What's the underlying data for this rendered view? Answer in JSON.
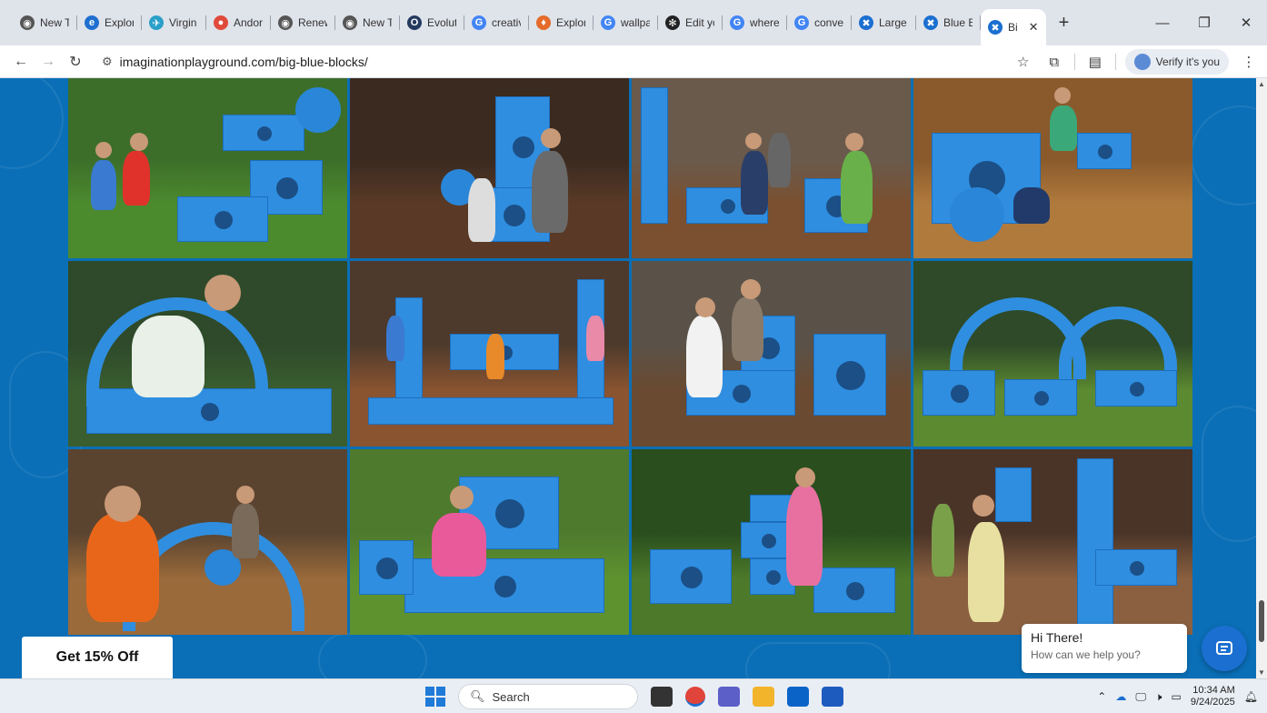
{
  "browser": {
    "tabs": [
      {
        "title": "New T",
        "icon": "chrome-icon",
        "color": "#555555",
        "glyph": "◉"
      },
      {
        "title": "Explor",
        "icon": "edge-icon",
        "color": "#1f6fd0",
        "glyph": "e"
      },
      {
        "title": "Virgin",
        "icon": "airline-icon",
        "color": "#2aa0c8",
        "glyph": "✈"
      },
      {
        "title": "Andor",
        "icon": "maps-pin-icon",
        "color": "#e04a3a",
        "glyph": "●"
      },
      {
        "title": "Renew",
        "icon": "chrome-icon",
        "color": "#555555",
        "glyph": "◉"
      },
      {
        "title": "New T",
        "icon": "chrome-icon",
        "color": "#555555",
        "glyph": "◉"
      },
      {
        "title": "Evoluti",
        "icon": "evolution-icon",
        "color": "#243a5e",
        "glyph": "O"
      },
      {
        "title": "creativ",
        "icon": "google-icon",
        "color": "#4285f4",
        "glyph": "G"
      },
      {
        "title": "Explor",
        "icon": "flame-icon",
        "color": "#e46b2a",
        "glyph": "♦"
      },
      {
        "title": "wallpa",
        "icon": "google-icon",
        "color": "#4285f4",
        "glyph": "G"
      },
      {
        "title": "Edit yc",
        "icon": "openai-icon",
        "color": "#222222",
        "glyph": "✻"
      },
      {
        "title": "where",
        "icon": "google-icon",
        "color": "#4285f4",
        "glyph": "G"
      },
      {
        "title": "conve",
        "icon": "google-icon",
        "color": "#4285f4",
        "glyph": "G"
      },
      {
        "title": "Large",
        "icon": "playground-icon",
        "color": "#1a6fd0",
        "glyph": "✖"
      },
      {
        "title": "Blue B",
        "icon": "playground-icon",
        "color": "#1a6fd0",
        "glyph": "✖"
      }
    ],
    "active_tab": {
      "title": "Bi",
      "icon": "playground-icon",
      "color": "#1a6fd0",
      "glyph": "✖"
    },
    "new_tab": "+",
    "url": "imaginationplayground.com/big-blue-blocks/",
    "profile_label": "Verify it's you"
  },
  "page": {
    "accent": "#0a6fb7",
    "promo_label": "Get 15% Off",
    "chat": {
      "greeting": "Hi There!",
      "prompt": "How can we help you?"
    }
  },
  "photos": [
    {
      "name": "photo-kids-stacking-lawn",
      "sky": "#3c6e2a",
      "floor": "#4c8a2e"
    },
    {
      "name": "photo-boy-carrying-blocks",
      "sky": "#3a2a20",
      "floor": "#5a3a26"
    },
    {
      "name": "photo-boys-building-hall",
      "sky": "#6a5a4c",
      "floor": "#7a5030"
    },
    {
      "name": "photo-overhead-kids-floor",
      "sky": "#8a5a2c",
      "floor": "#b07a3c"
    },
    {
      "name": "photo-boy-climbing-blocks",
      "sky": "#2e4a2a",
      "floor": "#3a5e30"
    },
    {
      "name": "photo-group-play-hall",
      "sky": "#4e3a2c",
      "floor": "#8a5430"
    },
    {
      "name": "photo-two-boys-stone-wall",
      "sky": "#5a5248",
      "floor": "#6a4a30"
    },
    {
      "name": "photo-blue-arches-grass",
      "sky": "#2e4a28",
      "floor": "#5c8a30"
    },
    {
      "name": "photo-toddler-curved-track",
      "sky": "#5a4430",
      "floor": "#9a6a3a"
    },
    {
      "name": "photo-girl-sitting-grass",
      "sky": "#4e7a2e",
      "floor": "#5e922e"
    },
    {
      "name": "photo-girl-stacking-garden",
      "sky": "#2a4e1e",
      "floor": "#4c7a2a"
    },
    {
      "name": "photo-girl-lifting-block",
      "sky": "#4a3428",
      "floor": "#8a6040"
    }
  ],
  "taskbar": {
    "search_placeholder": "Search",
    "time": "10:34 AM",
    "date": "9/24/2025",
    "apps": [
      {
        "name": "task-view-icon",
        "color": "#333333"
      },
      {
        "name": "chrome-icon",
        "color": "#e0443a"
      },
      {
        "name": "teams-icon",
        "color": "#5b5fc7"
      },
      {
        "name": "file-explorer-icon",
        "color": "#f2b42a"
      },
      {
        "name": "outlook-icon",
        "color": "#0a64c8"
      },
      {
        "name": "word-icon",
        "color": "#1e5bbf"
      }
    ]
  }
}
